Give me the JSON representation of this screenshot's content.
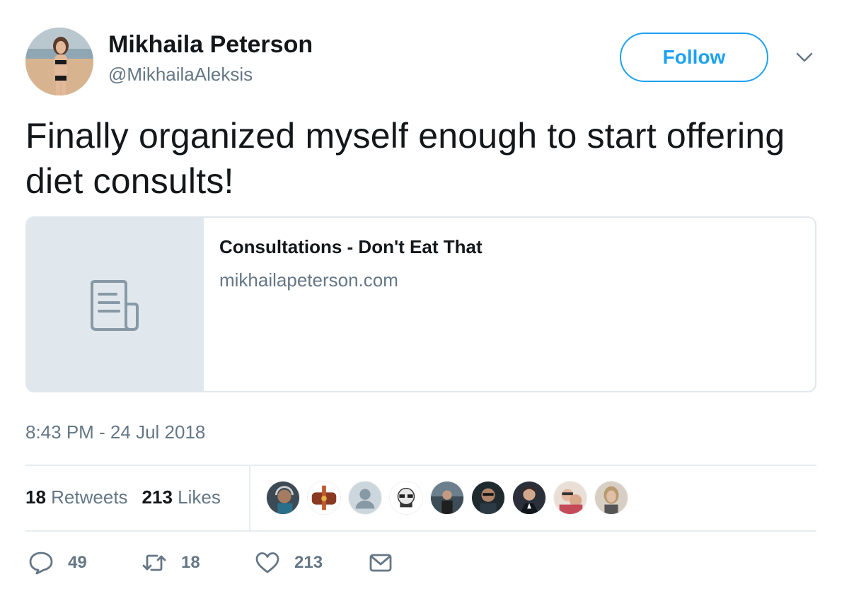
{
  "author": {
    "name": "Mikhaila Peterson",
    "handle": "@MikhailaAleksis"
  },
  "follow_label": "Follow",
  "tweet": {
    "text": "Finally organized myself enough to start offering diet consults!",
    "timestamp": "8:43 PM - 24 Jul 2018"
  },
  "card": {
    "title": "Consultations - Don't Eat That",
    "domain": "mikhailapeterson.com",
    "icon": "document-icon"
  },
  "stats": {
    "retweets_count": "18",
    "retweets_label": "Retweets",
    "likes_count": "213",
    "likes_label": "Likes"
  },
  "actions": {
    "reply_count": "49",
    "retweet_count": "18",
    "like_count": "213"
  },
  "colors": {
    "accent": "#1da1f2",
    "text": "#14171a",
    "secondary": "#657786",
    "border": "#e1e8ed"
  }
}
